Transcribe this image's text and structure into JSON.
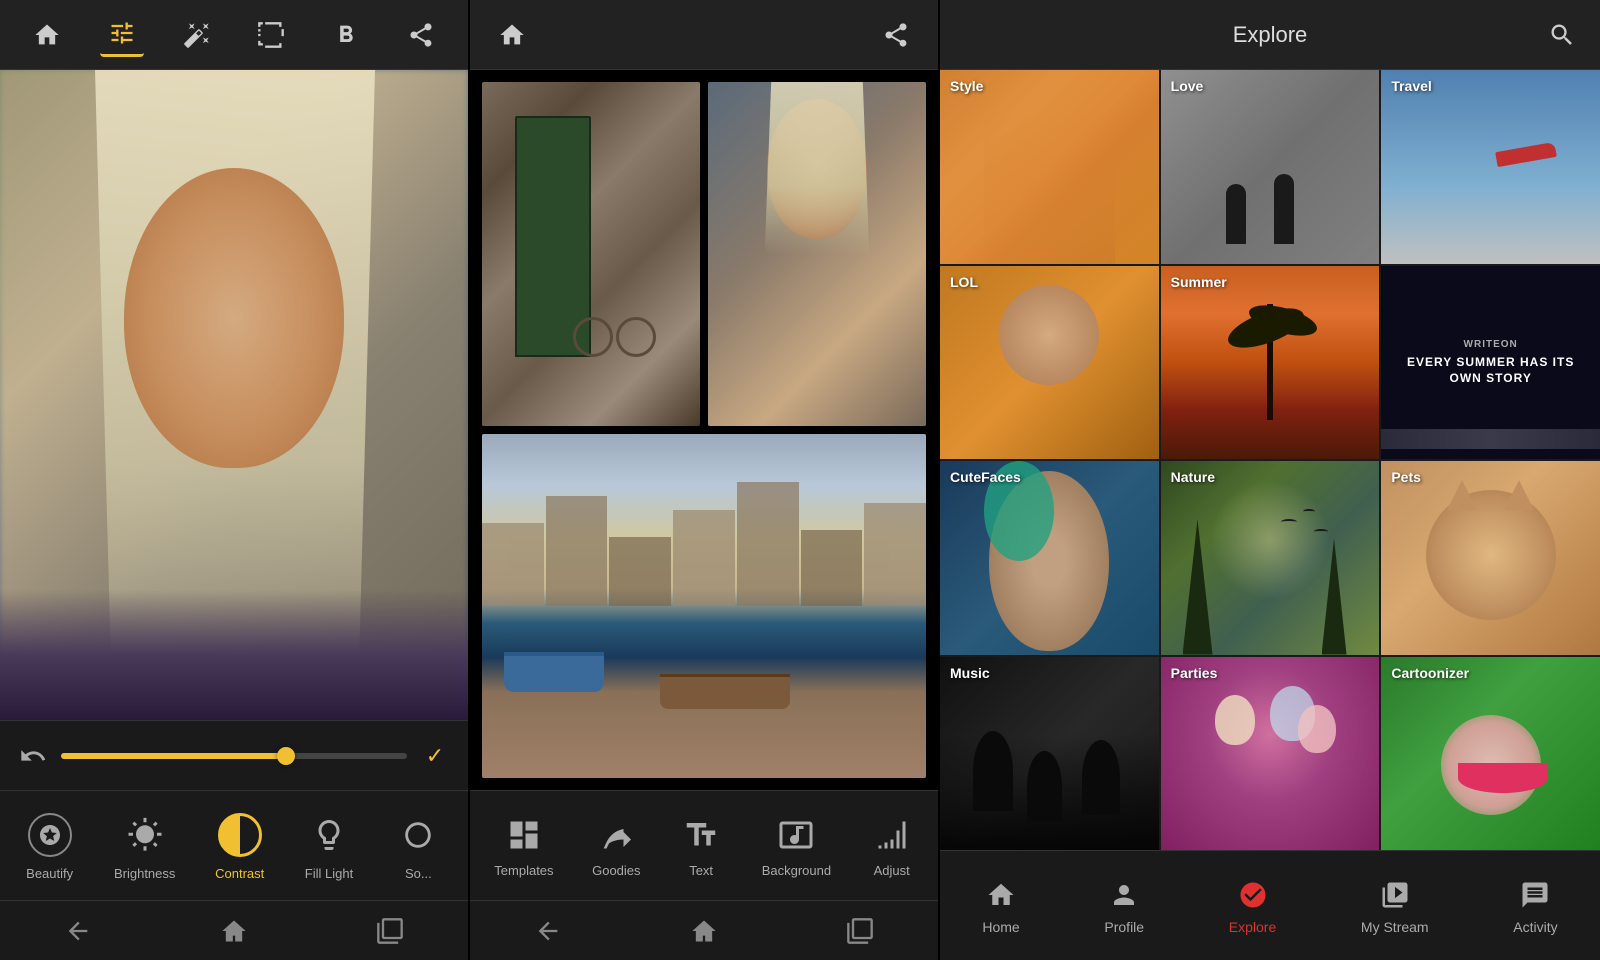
{
  "panel1": {
    "toolbar": {
      "icons": [
        "home",
        "adjust",
        "wand",
        "frame",
        "bold-b",
        "share"
      ]
    },
    "tools": [
      {
        "id": "beautify",
        "label": "Beautify",
        "active": false
      },
      {
        "id": "brightness",
        "label": "Brightness",
        "active": false
      },
      {
        "id": "contrast",
        "label": "Contrast",
        "active": true
      },
      {
        "id": "filllight",
        "label": "Fill Light",
        "active": false
      },
      {
        "id": "soften",
        "label": "So...",
        "active": false
      }
    ],
    "slider_value": 65
  },
  "panel2": {
    "tools": [
      {
        "id": "templates",
        "label": "Templates",
        "active": false
      },
      {
        "id": "goodies",
        "label": "Goodies",
        "active": false
      },
      {
        "id": "text",
        "label": "Text",
        "active": false
      },
      {
        "id": "background",
        "label": "Background",
        "active": false
      },
      {
        "id": "adjust",
        "label": "Adjust",
        "active": false
      }
    ]
  },
  "panel3": {
    "header": {
      "title": "Explore"
    },
    "categories": [
      {
        "id": "style",
        "label": "Style",
        "bg": "style"
      },
      {
        "id": "love",
        "label": "Love",
        "bg": "love"
      },
      {
        "id": "travel",
        "label": "Travel",
        "bg": "travel"
      },
      {
        "id": "lol",
        "label": "LOL",
        "bg": "lol"
      },
      {
        "id": "summer",
        "label": "Summer",
        "bg": "summer"
      },
      {
        "id": "writeon",
        "label": "WriteOn",
        "bg": "writeon"
      },
      {
        "id": "cutefaces",
        "label": "CuteFaces",
        "bg": "cutefaces"
      },
      {
        "id": "nature",
        "label": "Nature",
        "bg": "nature"
      },
      {
        "id": "pets",
        "label": "Pets",
        "bg": "pets"
      },
      {
        "id": "music",
        "label": "Music",
        "bg": "music"
      },
      {
        "id": "parties",
        "label": "Parties",
        "bg": "parties"
      },
      {
        "id": "cartoonizer",
        "label": "Cartoonizer",
        "bg": "cartoonizer"
      }
    ],
    "nav": [
      {
        "id": "home",
        "label": "Home",
        "active": false
      },
      {
        "id": "profile",
        "label": "Profile",
        "active": false
      },
      {
        "id": "explore",
        "label": "Explore",
        "active": true
      },
      {
        "id": "mystream",
        "label": "My Stream",
        "active": false
      },
      {
        "id": "activity",
        "label": "Activity",
        "active": false
      }
    ],
    "writeon_text": "EVERY SUMMER HAS ITS OWN STORY"
  }
}
